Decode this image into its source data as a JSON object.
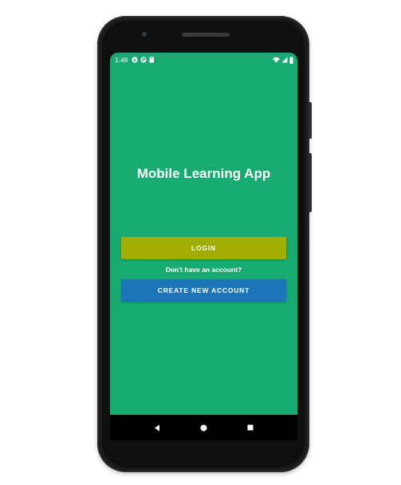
{
  "status_bar": {
    "time": "1:48",
    "left_icons": [
      "android-auto-icon",
      "p-badge-icon",
      "sd-card-icon"
    ],
    "right_icons": [
      "wifi-icon",
      "cell-signal-icon",
      "battery-icon"
    ]
  },
  "app": {
    "title": "Mobile Learning App",
    "background_color": "#17ab72"
  },
  "actions": {
    "login_label": "LOGIN",
    "login_color": "#a1ad00",
    "prompt_text": "Don't have an account?",
    "create_account_label": "CREATE NEW ACCOUNT",
    "create_account_color": "#1c75b5"
  },
  "nav_bar": {
    "buttons": [
      "back-icon",
      "home-icon",
      "recents-icon"
    ]
  }
}
